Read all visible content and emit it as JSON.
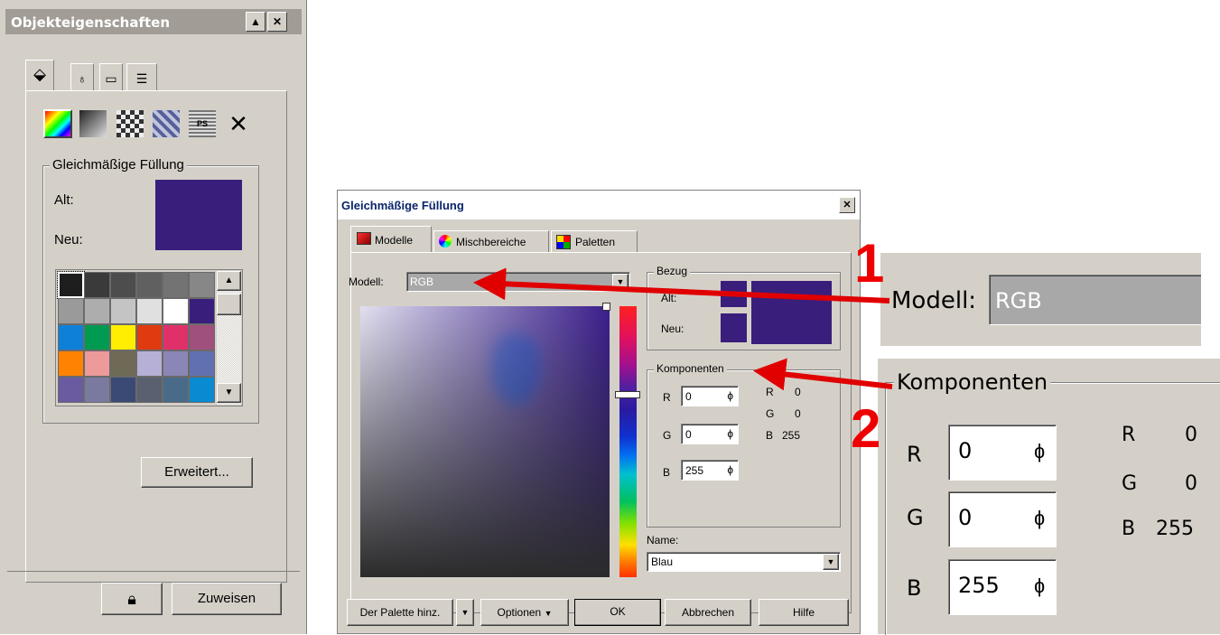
{
  "docker": {
    "title": "Objekteigenschaften",
    "title_buttons": [
      "▲",
      "✕"
    ],
    "tabs": [
      "fill-tab",
      "outline-tab",
      "general-tab",
      "summary-tab"
    ],
    "fill_types": [
      "uniform-fill",
      "fountain-fill",
      "pattern-fill",
      "texture-fill",
      "postscript-fill",
      "no-fill"
    ],
    "group_label": "Gleichmäßige Füllung",
    "alt_label": "Alt:",
    "neu_label": "Neu:",
    "swatch_colors": [
      [
        "#1e1e1e",
        "#3a3a3a",
        "#4d4d4d",
        "#606060",
        "#737373",
        "#878787"
      ],
      [
        "#9a9a9a",
        "#adadad",
        "#c4c4c4",
        "#e0e0e0",
        "#ffffff",
        "#3a1e7c"
      ],
      [
        "#0f80d8",
        "#009a50",
        "#ffee00",
        "#e03a10",
        "#e0306a",
        "#a0507c"
      ],
      [
        "#ff8200",
        "#ee9a9a",
        "#6f6a55",
        "#b6b0d6",
        "#8a86b6",
        "#6070b0"
      ],
      [
        "#6a5aa0",
        "#7a7aa0",
        "#3a4a74",
        "#5a6070",
        "#4a6a8a",
        "#0a8ad0"
      ]
    ],
    "erweitert_label": "Erweitert...",
    "zuweisen_label": "Zuweisen",
    "current_color": "#3a1e7c"
  },
  "dialog": {
    "title": "Gleichmäßige Füllung",
    "tabs": [
      "Modelle",
      "Mischbereiche",
      "Paletten"
    ],
    "modell_label": "Modell:",
    "modell_value": "RGB",
    "bezug_label": "Bezug",
    "alt_label": "Alt:",
    "neu_label": "Neu:",
    "komponenten_label": "Komponenten",
    "components": [
      {
        "label": "R",
        "value": "0"
      },
      {
        "label": "G",
        "value": "0"
      },
      {
        "label": "B",
        "value": "255"
      }
    ],
    "readout": [
      {
        "label": "R",
        "value": "0"
      },
      {
        "label": "G",
        "value": "0"
      },
      {
        "label": "B",
        "value": "255"
      }
    ],
    "name_label": "Name:",
    "name_value": "Blau",
    "buttons": {
      "palette": "Der Palette hinz.",
      "optionen": "Optionen",
      "ok": "OK",
      "abbrechen": "Abbrechen",
      "hilfe": "Hilfe"
    },
    "close": "✕"
  },
  "annotations": {
    "callout_1": "1",
    "callout_2": "2",
    "arrow_color": "#e00000"
  },
  "zoom1": {
    "label": "Modell:",
    "value": "RGB"
  },
  "zoom2": {
    "label": "Komponenten",
    "components": [
      {
        "label": "R",
        "value": "0"
      },
      {
        "label": "G",
        "value": "0"
      },
      {
        "label": "B",
        "value": "255"
      }
    ],
    "readout": [
      {
        "label": "R",
        "value": "0"
      },
      {
        "label": "G",
        "value": "0"
      },
      {
        "label": "B",
        "value": "255"
      }
    ]
  }
}
